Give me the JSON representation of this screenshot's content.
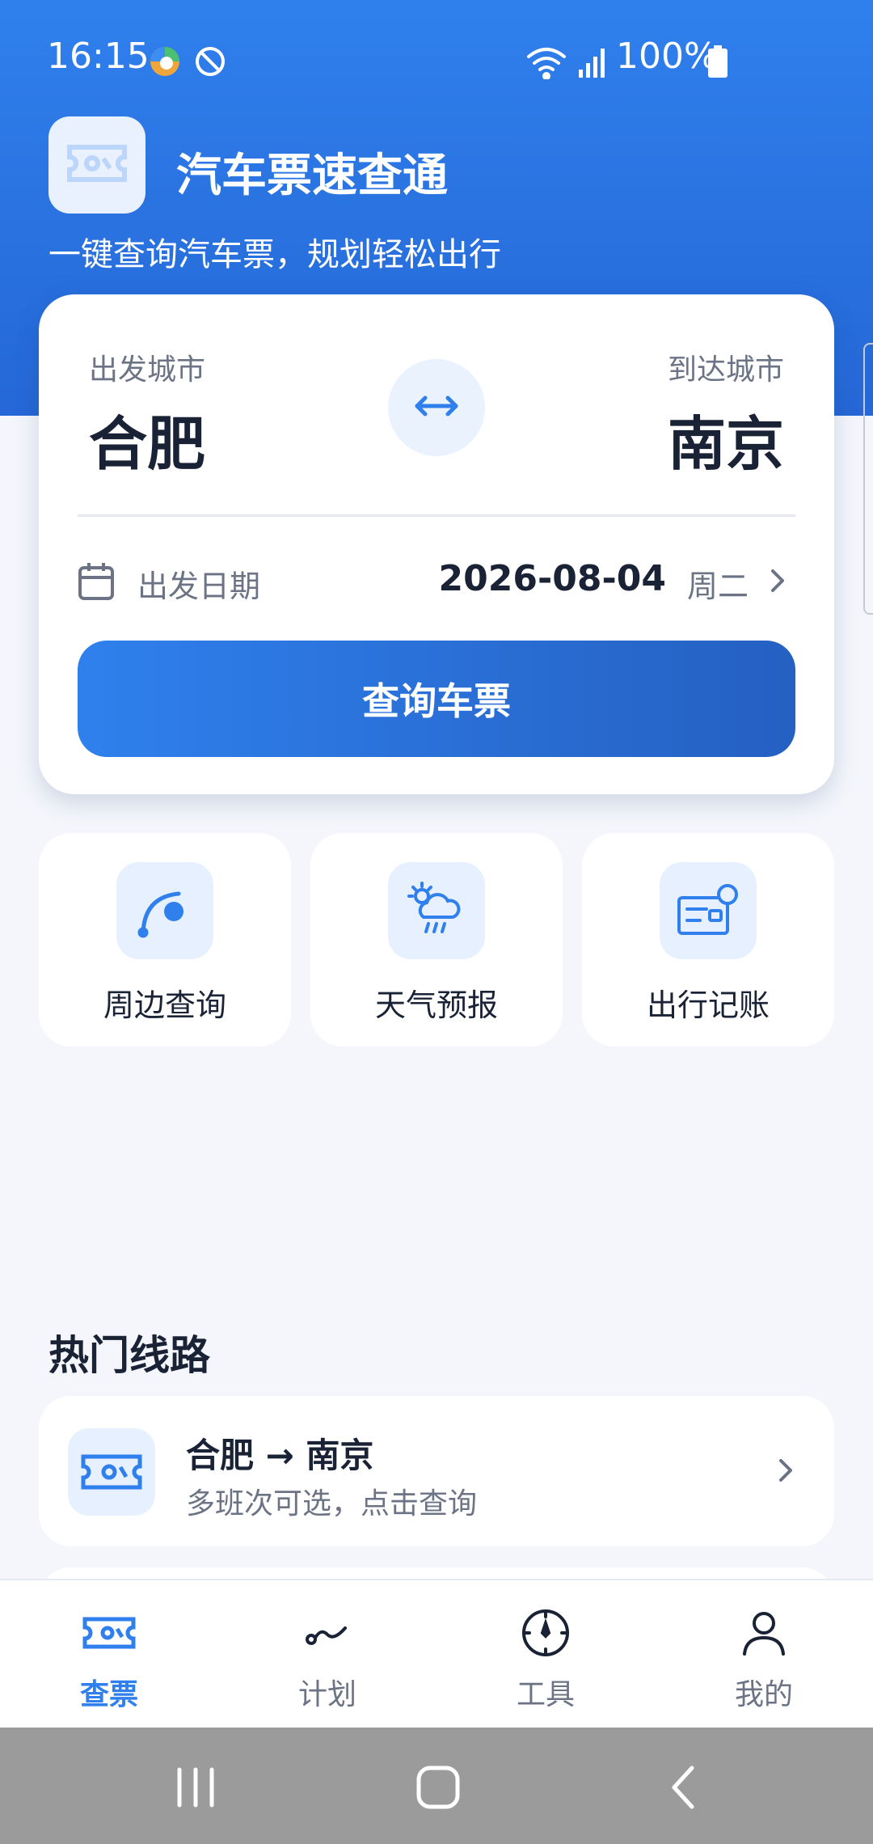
{
  "status_bar": {
    "time": "16:15",
    "battery": "100%"
  },
  "header": {
    "title": "汽车票速查通",
    "subtitle": "一键查询汽车票，规划轻松出行"
  },
  "search": {
    "from_label": "出发城市",
    "from_city": "合肥",
    "to_label": "到达城市",
    "to_city": "南京",
    "date_label": "出发日期",
    "date_value": "2026-08-04",
    "weekday": "周二",
    "query_button": "查询车票"
  },
  "tools": [
    {
      "label": "周边查询",
      "icon": "route-icon"
    },
    {
      "label": "天气预报",
      "icon": "weather-icon"
    },
    {
      "label": "出行记账",
      "icon": "wallet-icon"
    }
  ],
  "popular": {
    "title": "热门线路",
    "routes": [
      {
        "title": "合肥 → 南京",
        "subtitle": "多班次可选，点击查询"
      }
    ]
  },
  "tabbar": {
    "items": [
      {
        "label": "查票",
        "icon": "ticket-icon",
        "active": true
      },
      {
        "label": "计划",
        "icon": "route-icon"
      },
      {
        "label": "工具",
        "icon": "compass-icon"
      },
      {
        "label": "我的",
        "icon": "person-icon"
      }
    ]
  },
  "colors": {
    "primary": "#2f80ed",
    "primary_dark": "#2560c2",
    "background": "#f4f6fb",
    "text": "#1a2236",
    "muted": "#6b7385"
  }
}
